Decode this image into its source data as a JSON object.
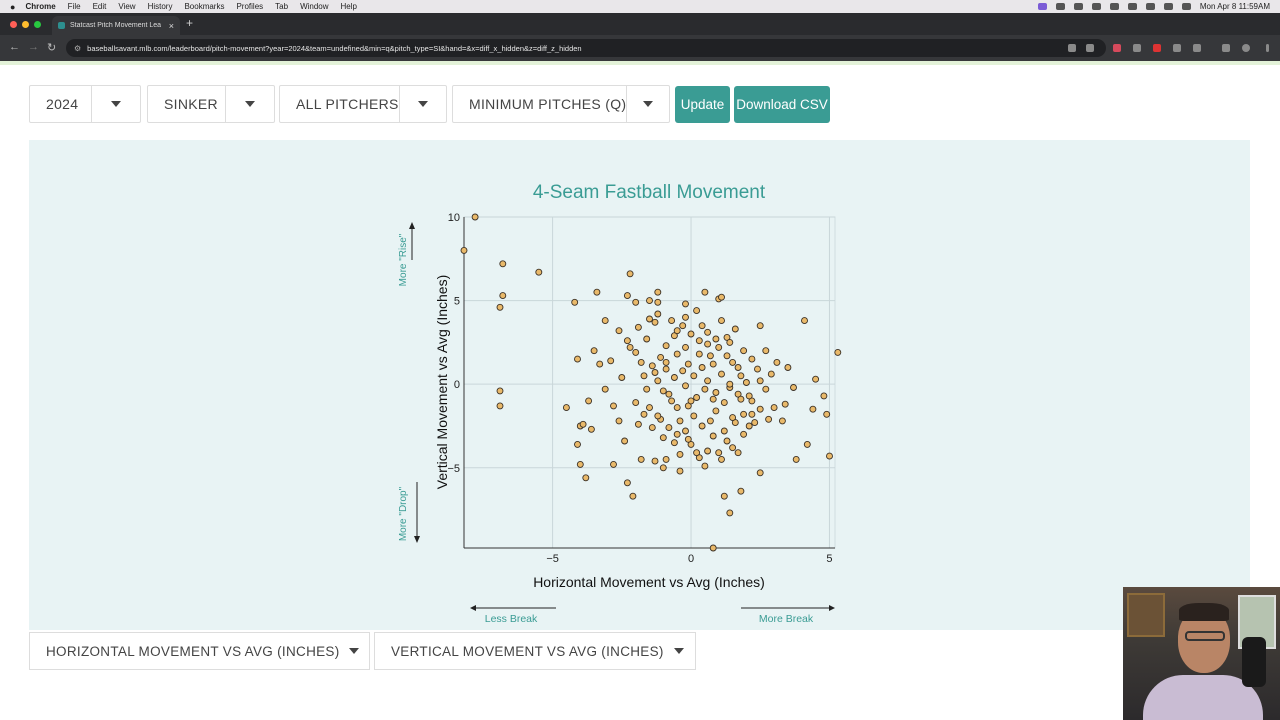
{
  "menubar": {
    "items": [
      "Chrome",
      "File",
      "Edit",
      "View",
      "History",
      "Bookmarks",
      "Profiles",
      "Tab",
      "Window",
      "Help"
    ],
    "clock": "Mon Apr 8  11:59AM"
  },
  "browser": {
    "tab_title": "Statcast Pitch Movement Lea",
    "url": "baseballsavant.mlb.com/leaderboard/pitch-movement?year=2024&team=undefined&min=q&pitch_type=SI&hand=&x=diff_x_hidden&z=diff_z_hidden"
  },
  "filters": {
    "year": "2024",
    "pitch_type": "SINKER",
    "pitchers": "ALL PITCHERS",
    "minimum": "MINIMUM PITCHES (Q)",
    "update_label": "Update",
    "download_label": "Download CSV"
  },
  "axis_selectors": {
    "x": "HORIZONTAL MOVEMENT VS AVG (INCHES)",
    "y": "VERTICAL MOVEMENT VS AVG (INCHES)"
  },
  "colors": {
    "title": "#3a9c94",
    "accent": "#3a9c94",
    "point_fill": "#e9b96a",
    "point_stroke": "#3b3126"
  },
  "chart_data": {
    "type": "scatter",
    "title": "4-Seam Fastball Movement",
    "xlabel": "Horizontal Movement vs Avg (Inches)",
    "ylabel": "Vertical Movement vs Avg (Inches)",
    "xlim": [
      -8.2,
      5.2
    ],
    "ylim": [
      -9.8,
      10
    ],
    "xticks": [
      -5,
      0,
      5
    ],
    "yticks": [
      -5,
      0,
      5,
      10
    ],
    "xtick_labels": [
      "−5",
      "0",
      "5"
    ],
    "ytick_labels": [
      "−5",
      "0",
      "5",
      "10"
    ],
    "grid": true,
    "annotations": {
      "top_y": "More \"Rise\"",
      "bottom_y": "More \"Drop\"",
      "left_x": "Less Break",
      "right_x": "More Break"
    },
    "points": [
      [
        -7.8,
        10
      ],
      [
        -8.2,
        8
      ],
      [
        -6.8,
        7.2
      ],
      [
        -5.5,
        6.7
      ],
      [
        -6.8,
        5.3
      ],
      [
        -6.9,
        4.6
      ],
      [
        -6.9,
        -0.4
      ],
      [
        -6.9,
        -1.3
      ],
      [
        -4.2,
        4.9
      ],
      [
        -4.1,
        1.5
      ],
      [
        -3.4,
        5.5
      ],
      [
        -3.1,
        3.8
      ],
      [
        -2.2,
        6.6
      ],
      [
        -2.3,
        5.3
      ],
      [
        -2.0,
        4.9
      ],
      [
        -1.2,
        5.5
      ],
      [
        -1.5,
        5.0
      ],
      [
        -1.2,
        4.9
      ],
      [
        -0.2,
        4.8
      ],
      [
        0.5,
        5.5
      ],
      [
        1.0,
        5.1
      ],
      [
        1.1,
        5.2
      ],
      [
        -4.0,
        -2.5
      ],
      [
        -3.9,
        -2.4
      ],
      [
        -3.7,
        -1.0
      ],
      [
        -2.6,
        -2.2
      ],
      [
        -4.5,
        -1.4
      ],
      [
        -3.5,
        2.0
      ],
      [
        -3.3,
        1.2
      ],
      [
        -3.6,
        -2.7
      ],
      [
        -4.1,
        -3.6
      ],
      [
        -4.0,
        -4.8
      ],
      [
        -3.8,
        -5.6
      ],
      [
        -2.8,
        -4.8
      ],
      [
        -2.3,
        -5.9
      ],
      [
        -2.1,
        -6.7
      ],
      [
        -1.8,
        -4.5
      ],
      [
        -1.3,
        -4.6
      ],
      [
        -0.9,
        -4.5
      ],
      [
        -0.4,
        -5.2
      ],
      [
        0.3,
        -4.4
      ],
      [
        0.5,
        -4.9
      ],
      [
        1.2,
        -6.7
      ],
      [
        1.4,
        -7.7
      ],
      [
        0.8,
        -9.8
      ],
      [
        1.8,
        -6.4
      ],
      [
        2.5,
        -5.3
      ],
      [
        3.8,
        -4.5
      ],
      [
        4.2,
        -3.6
      ],
      [
        5.0,
        -4.3
      ],
      [
        4.9,
        -1.8
      ],
      [
        4.4,
        -1.5
      ],
      [
        4.8,
        -0.7
      ],
      [
        4.5,
        0.3
      ],
      [
        4.1,
        3.8
      ],
      [
        5.3,
        1.9
      ],
      [
        2.5,
        3.5
      ],
      [
        3.1,
        1.3
      ],
      [
        2.9,
        0.6
      ],
      [
        2.7,
        -0.3
      ],
      [
        2.2,
        -1.0
      ],
      [
        1.9,
        -1.8
      ],
      [
        3.0,
        -1.4
      ],
      [
        3.3,
        -2.2
      ],
      [
        1.5,
        1.3
      ],
      [
        1.8,
        0.5
      ],
      [
        2.1,
        -0.7
      ],
      [
        1.4,
        -0.2
      ],
      [
        1.6,
        -2.3
      ],
      [
        1.3,
        -3.4
      ],
      [
        1.0,
        -4.1
      ],
      [
        0.8,
        -3.1
      ],
      [
        0.4,
        -2.5
      ],
      [
        0.1,
        -1.9
      ],
      [
        -0.2,
        -2.8
      ],
      [
        -0.6,
        -3.5
      ],
      [
        -1.0,
        -3.2
      ],
      [
        -1.4,
        -2.6
      ],
      [
        -1.7,
        -1.8
      ],
      [
        -2.0,
        -1.1
      ],
      [
        -1.6,
        -0.3
      ],
      [
        -1.2,
        0.2
      ],
      [
        -0.8,
        -0.6
      ],
      [
        -0.5,
        -1.4
      ],
      [
        -0.2,
        -0.1
      ],
      [
        0.1,
        0.5
      ],
      [
        0.4,
        1.0
      ],
      [
        0.6,
        0.2
      ],
      [
        0.9,
        -0.5
      ],
      [
        1.2,
        -1.1
      ],
      [
        0.7,
        1.7
      ],
      [
        1.0,
        2.2
      ],
      [
        1.3,
        2.8
      ],
      [
        1.6,
        3.3
      ],
      [
        0.3,
        2.6
      ],
      [
        0.0,
        3.0
      ],
      [
        -0.3,
        3.5
      ],
      [
        -0.6,
        2.9
      ],
      [
        -0.9,
        2.3
      ],
      [
        -1.1,
        1.6
      ],
      [
        -1.4,
        1.1
      ],
      [
        -1.7,
        0.5
      ],
      [
        -2.0,
        1.9
      ],
      [
        -2.3,
        2.6
      ],
      [
        -2.6,
        3.2
      ],
      [
        -2.9,
        1.4
      ],
      [
        -2.5,
        0.4
      ],
      [
        -3.1,
        -0.3
      ],
      [
        -1.3,
        3.7
      ],
      [
        -0.7,
        3.8
      ],
      [
        -0.2,
        4.0
      ],
      [
        0.2,
        4.4
      ],
      [
        0.6,
        3.1
      ],
      [
        1.1,
        3.8
      ],
      [
        1.4,
        2.5
      ],
      [
        1.9,
        2.0
      ],
      [
        2.2,
        1.5
      ],
      [
        2.4,
        0.9
      ],
      [
        2.0,
        0.1
      ],
      [
        1.7,
        -0.6
      ],
      [
        2.5,
        -1.5
      ],
      [
        2.8,
        -2.1
      ],
      [
        0.2,
        -0.8
      ],
      [
        -0.1,
        -1.3
      ],
      [
        -0.4,
        -2.2
      ],
      [
        -0.7,
        -1.0
      ],
      [
        -1.0,
        -0.4
      ],
      [
        -1.3,
        0.7
      ],
      [
        -0.9,
        1.3
      ],
      [
        -0.5,
        1.8
      ],
      [
        -0.1,
        1.2
      ],
      [
        0.3,
        1.8
      ],
      [
        0.8,
        1.2
      ],
      [
        1.1,
        0.6
      ],
      [
        1.4,
        0.0
      ],
      [
        1.8,
        -0.9
      ],
      [
        2.3,
        -2.3
      ],
      [
        1.9,
        -3.0
      ],
      [
        1.5,
        -3.8
      ],
      [
        1.1,
        -4.5
      ],
      [
        0.6,
        -4.0
      ],
      [
        0.0,
        -3.6
      ],
      [
        -0.5,
        -3.0
      ],
      [
        -1.1,
        -2.1
      ],
      [
        -1.5,
        -1.4
      ],
      [
        -1.9,
        -2.4
      ],
      [
        -2.4,
        -3.4
      ],
      [
        -0.3,
        0.8
      ],
      [
        0.5,
        -0.3
      ],
      [
        -0.6,
        0.4
      ],
      [
        0.9,
        2.7
      ],
      [
        -1.6,
        2.7
      ],
      [
        -1.9,
        3.4
      ],
      [
        -1.2,
        4.2
      ],
      [
        -0.5,
        3.2
      ],
      [
        0.4,
        3.5
      ],
      [
        1.3,
        1.7
      ],
      [
        2.7,
        2.0
      ],
      [
        3.5,
        1.0
      ],
      [
        3.7,
        -0.2
      ],
      [
        3.4,
        -1.2
      ],
      [
        -2.8,
        -1.3
      ],
      [
        -0.8,
        -2.6
      ],
      [
        0.7,
        -2.2
      ],
      [
        1.5,
        -2.0
      ],
      [
        2.1,
        -2.5
      ],
      [
        -1.0,
        -5.0
      ],
      [
        -0.1,
        -3.3
      ],
      [
        0.2,
        -4.1
      ],
      [
        0.9,
        -1.6
      ],
      [
        -0.2,
        2.2
      ],
      [
        -0.9,
        0.9
      ],
      [
        0.0,
        -1.0
      ],
      [
        0.6,
        2.4
      ],
      [
        1.7,
        1.0
      ],
      [
        2.5,
        0.2
      ],
      [
        -1.5,
        3.9
      ],
      [
        -2.2,
        2.2
      ],
      [
        -1.8,
        1.3
      ],
      [
        -1.2,
        -1.9
      ],
      [
        -0.4,
        -4.2
      ],
      [
        0.8,
        -0.9
      ],
      [
        1.2,
        -2.8
      ],
      [
        1.7,
        -4.1
      ],
      [
        2.2,
        -1.8
      ]
    ]
  }
}
